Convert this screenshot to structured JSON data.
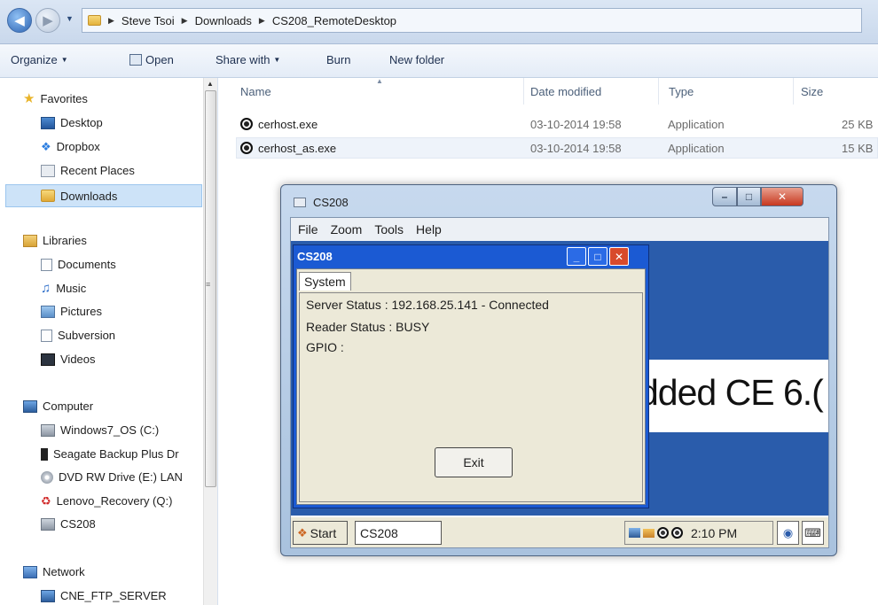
{
  "address_bar": {
    "breadcrumbs": [
      "Steve Tsoi",
      "Downloads",
      "CS208_RemoteDesktop"
    ]
  },
  "toolbar": {
    "organize": "Organize",
    "open": "Open",
    "share_with": "Share with",
    "burn": "Burn",
    "new_folder": "New folder"
  },
  "sidebar": {
    "favorites": {
      "label": "Favorites",
      "items": [
        "Desktop",
        "Dropbox",
        "Recent Places",
        "Downloads"
      ]
    },
    "libraries": {
      "label": "Libraries",
      "items": [
        "Documents",
        "Music",
        "Pictures",
        "Subversion",
        "Videos"
      ]
    },
    "computer": {
      "label": "Computer",
      "items": [
        "Windows7_OS (C:)",
        "Seagate Backup Plus Dr",
        "DVD RW Drive (E:) LAN",
        "Lenovo_Recovery (Q:)",
        "CS208"
      ]
    },
    "network": {
      "label": "Network",
      "items": [
        "CNE_FTP_SERVER"
      ]
    },
    "selected": "Downloads"
  },
  "file_list": {
    "columns": [
      "Name",
      "Date modified",
      "Type",
      "Size"
    ],
    "rows": [
      {
        "name": "cerhost.exe",
        "date": "03-10-2014 19:58",
        "type": "Application",
        "size": "25 KB"
      },
      {
        "name": "cerhost_as.exe",
        "date": "03-10-2014 19:58",
        "type": "Application",
        "size": "15 KB"
      }
    ]
  },
  "remote_window": {
    "title": "CS208",
    "menu": [
      "File",
      "Zoom",
      "Tools",
      "Help"
    ],
    "desktop_banner": "dded CE 6.(",
    "app": {
      "title": "CS208",
      "tab": "System",
      "server_status": "Server Status : 192.168.25.141 - Connected",
      "reader_status": "Reader Status : BUSY",
      "gpio": "GPIO :",
      "exit_label": "Exit"
    },
    "taskbar": {
      "start": "Start",
      "task": "CS208",
      "clock": "2:10 PM"
    }
  },
  "colors": {
    "ce_desktop": "#2a5cab",
    "ce_titlebar": "#1b5ad3",
    "ce_close": "#d84a2b",
    "win7_close": "#c7381f"
  }
}
